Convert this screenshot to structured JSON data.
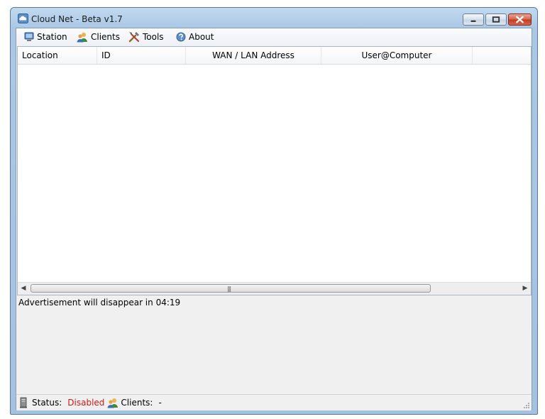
{
  "window": {
    "title": "Cloud Net - Beta v1.7",
    "icon": "cloud-app-icon"
  },
  "menu": {
    "items": [
      {
        "label": "Station",
        "icon": "monitor-icon"
      },
      {
        "label": "Clients",
        "icon": "users-icon"
      },
      {
        "label": "Tools",
        "icon": "tools-icon"
      },
      {
        "label": "About",
        "icon": "help-icon"
      }
    ]
  },
  "table": {
    "columns": [
      "Location",
      "ID",
      "WAN / LAN Address",
      "User@Computer"
    ],
    "rows": []
  },
  "ad": {
    "text": "Advertisement will disappear in 04:19"
  },
  "status": {
    "status_label": "Status:",
    "status_value": "Disabled",
    "clients_label": "Clients:",
    "clients_value": "-"
  },
  "colors": {
    "status_disabled": "#d11a1a",
    "title_gradient_top": "#c2d9ef",
    "close_button": "#c33a20"
  }
}
